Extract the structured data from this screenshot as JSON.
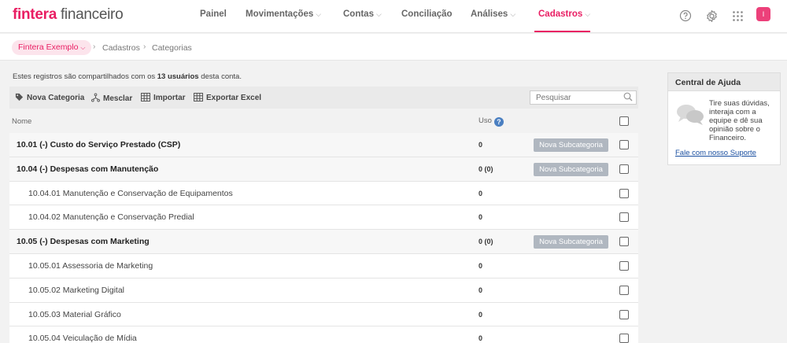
{
  "brand": {
    "name_bold": "fintera",
    "name_rest": " financeiro"
  },
  "nav": {
    "items": [
      {
        "label": "Painel",
        "dropdown": false
      },
      {
        "label": "Movimentações",
        "dropdown": true
      },
      {
        "label": "Contas",
        "dropdown": true
      },
      {
        "label": "Conciliação",
        "dropdown": false
      },
      {
        "label": "Análises",
        "dropdown": true
      },
      {
        "label": "Cadastros",
        "dropdown": true,
        "active": true
      }
    ],
    "caret": "⌵"
  },
  "topbar_icons": [
    "help-circle-icon",
    "gear-icon",
    "apps-grid-icon"
  ],
  "user": {
    "initial": "I"
  },
  "breadcrumb": {
    "org": "Fintera Exemplo",
    "org_caret": "⌵",
    "sep": "›",
    "items": [
      "Cadastros",
      "Categorias"
    ]
  },
  "info": {
    "prefix": "Estes registros são compartilhados com os ",
    "count": "13 usuários",
    "suffix": " desta conta."
  },
  "toolbar": {
    "new_category": "Nova Categoria",
    "merge": "Mesclar",
    "import": "Importar",
    "export": "Exportar Excel",
    "search_placeholder": "Pesquisar"
  },
  "table": {
    "col_name": "Nome",
    "col_usage": "Uso",
    "help_glyph": "?",
    "subcategory_button": "Nova Subcategoria",
    "rows": [
      {
        "name": "10.01 (-) Custo do Serviço Prestado (CSP)",
        "uso": "0",
        "level": "parent"
      },
      {
        "name": "10.04 (-) Despesas com Manutenção",
        "uso": "0 (0)",
        "level": "parent"
      },
      {
        "name": "10.04.01 Manutenção e Conservação de Equipamentos",
        "uso": "0",
        "level": "child"
      },
      {
        "name": "10.04.02 Manutenção e Conservação Predial",
        "uso": "0",
        "level": "child"
      },
      {
        "name": "10.05 (-) Despesas com Marketing",
        "uso": "0 (0)",
        "level": "parent"
      },
      {
        "name": "10.05.01 Assessoria de Marketing",
        "uso": "0",
        "level": "child"
      },
      {
        "name": "10.05.02 Marketing Digital",
        "uso": "0",
        "level": "child"
      },
      {
        "name": "10.05.03 Material Gráfico",
        "uso": "0",
        "level": "child"
      },
      {
        "name": "10.05.04 Veiculação de Mídia",
        "uso": "0",
        "level": "child"
      }
    ]
  },
  "help": {
    "title": "Central de Ajuda",
    "text": "Tire suas dúvidas, interaja com a equipe e dê sua opinião sobre o Financeiro.",
    "link": "Fale com nosso Suporte"
  },
  "colors": {
    "accent": "#e91e63",
    "subbutton": "#b0b7c0",
    "link": "#1a4fa0"
  }
}
